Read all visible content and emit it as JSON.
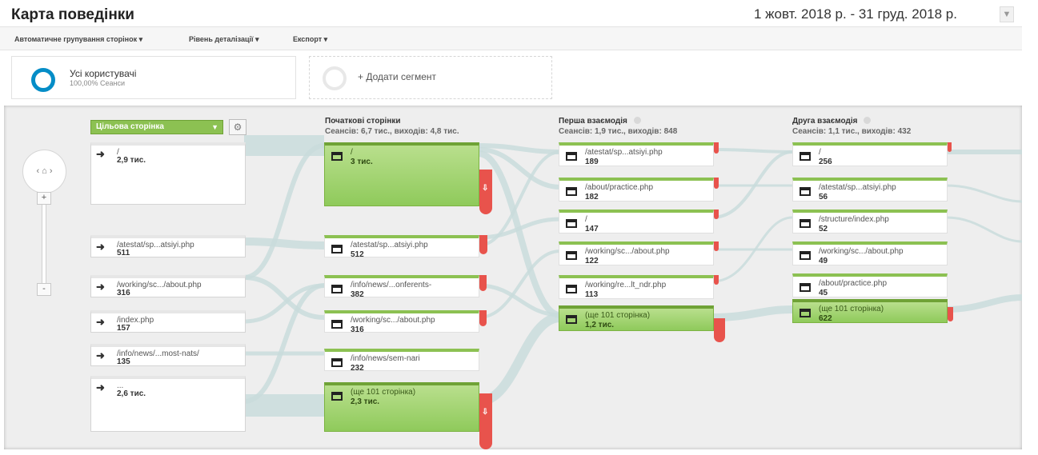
{
  "header": {
    "title": "Карта поведінки",
    "date_range": "1 жовт. 2018 р. - 31 груд. 2018 р."
  },
  "toolbar": {
    "grouping": "Автоматичне групування сторінок ▾",
    "detail": "Рівень деталізації ▾",
    "export": "Експорт ▾"
  },
  "segments": {
    "active": {
      "title": "Усі користувачі",
      "subtitle": "100,00% Сеанси"
    },
    "add": "+ Додати сегмент"
  },
  "controls": {
    "home": "‹ ⌂ ›",
    "zoom_in": "+",
    "zoom_out": "-",
    "dimension": "Цільова сторінка",
    "gear": "⚙"
  },
  "columns": [
    {
      "title": "Початкові сторінки",
      "stats": "Сеансів: 6,7 тис., виходів: 4,8 тис."
    },
    {
      "title": "Перша взаємодія",
      "stats": "Сеансів: 1,9 тис., виходів: 848"
    },
    {
      "title": "Друга взаємодія",
      "stats": "Сеансів: 1,1 тис., виходів: 432"
    }
  ],
  "sources": [
    {
      "label": "/",
      "value": "2,9 тис."
    },
    {
      "label": "/atestat/sp...atsiyi.php",
      "value": "511"
    },
    {
      "label": "/working/sc.../about.php",
      "value": "316"
    },
    {
      "label": "/index.php",
      "value": "157"
    },
    {
      "label": "/info/news/...most-nats/",
      "value": "135"
    },
    {
      "label": "...",
      "value": "2,6 тис."
    }
  ],
  "starting_pages": [
    {
      "label": "/",
      "value": "3 тис."
    },
    {
      "label": "/atestat/sp...atsiyi.php",
      "value": "512"
    },
    {
      "label": "/info/news/...onferents-",
      "value": "382"
    },
    {
      "label": "/working/sc.../about.php",
      "value": "316"
    },
    {
      "label": "/info/news/sem-nari",
      "value": "232"
    },
    {
      "label": "(ще 101 сторінка)",
      "value": "2,3 тис."
    }
  ],
  "first_interaction": [
    {
      "label": "/atestat/sp...atsiyi.php",
      "value": "189"
    },
    {
      "label": "/about/practice.php",
      "value": "182"
    },
    {
      "label": "/",
      "value": "147"
    },
    {
      "label": "/working/sc.../about.php",
      "value": "122"
    },
    {
      "label": "/working/re...lt_ndr.php",
      "value": "113"
    },
    {
      "label": "(ще 101 сторінка)",
      "value": "1,2 тис."
    }
  ],
  "second_interaction": [
    {
      "label": "/",
      "value": "256"
    },
    {
      "label": "/atestat/sp...atsiyi.php",
      "value": "56"
    },
    {
      "label": "/structure/index.php",
      "value": "52"
    },
    {
      "label": "/working/sc.../about.php",
      "value": "49"
    },
    {
      "label": "/about/practice.php",
      "value": "45"
    },
    {
      "label": "(ще 101 сторінка)",
      "value": "622"
    }
  ],
  "colors": {
    "node_green": "#8cc152",
    "drop_red": "#e8534c",
    "flow": "#c9dcdc",
    "segment_ring": "#058dc7"
  }
}
